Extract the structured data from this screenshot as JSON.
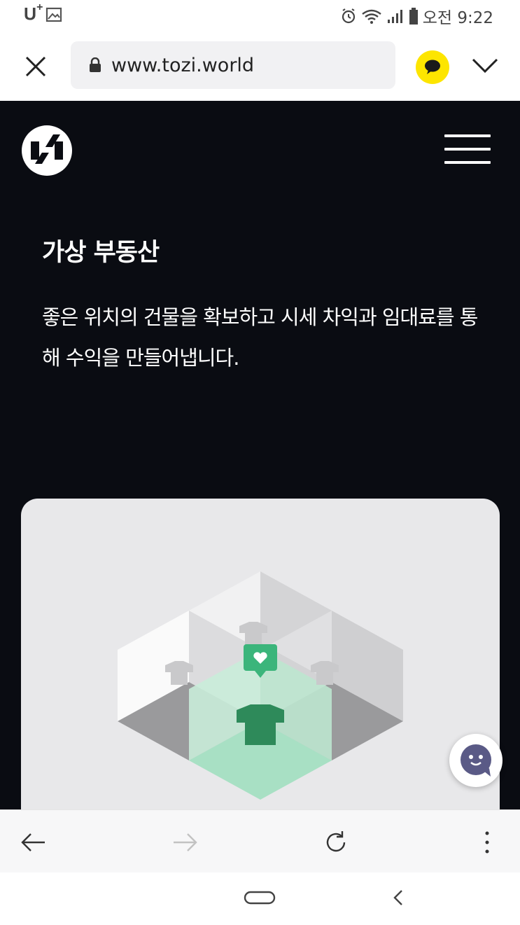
{
  "status_bar": {
    "carrier": "U",
    "carrier_sup": "+",
    "time": "오전 9:22"
  },
  "address_bar": {
    "url": "www.tozi.world"
  },
  "page": {
    "title": "가상 부동산",
    "description": "좋은 위치의 건물을 확보하고 시세 차익과 임대료를 통해 수익을 만들어냅니다."
  },
  "colors": {
    "page_background": "#0a0c12",
    "kakao_yellow": "#fde500",
    "accent_green": "#3bb57b",
    "card_background": "#e8e8ea"
  },
  "icons": {
    "close": "close-icon",
    "lock": "lock-icon",
    "kakao": "kakao-talk-icon",
    "chevron": "chevron-down-icon",
    "menu": "hamburger-menu-icon",
    "back": "arrow-left-icon",
    "forward": "arrow-right-icon",
    "reload": "reload-icon",
    "more": "more-vertical-icon",
    "chat": "chatbot-icon"
  }
}
